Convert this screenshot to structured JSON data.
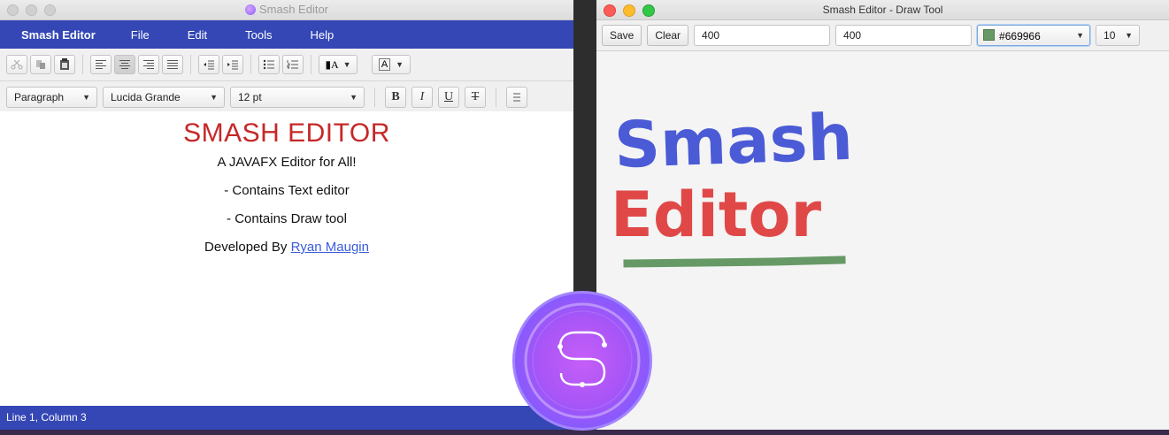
{
  "editor": {
    "window_title": "Smash Editor",
    "menu": [
      "Smash Editor",
      "File",
      "Edit",
      "Tools",
      "Help"
    ],
    "format": {
      "paragraph_style": "Paragraph",
      "font_family": "Lucida Grande",
      "font_size": "12 pt",
      "bold_label": "B",
      "italic_label": "I",
      "underline_label": "U",
      "strike_label": "T"
    },
    "document": {
      "heading": "SMASH EDITOR",
      "line1": "A JAVAFX Editor for All!",
      "line2": "- Contains Text editor",
      "line3": "- Contains Draw tool",
      "developed_prefix": "Developed By ",
      "developer_link": "Ryan Maugin"
    },
    "status": "Line 1, Column 3",
    "colors": {
      "accent": "#3447b5",
      "heading": "#c62828",
      "link": "#3b5bdb"
    }
  },
  "draw": {
    "window_title": "Smash Editor - Draw Tool",
    "save_label": "Save",
    "clear_label": "Clear",
    "width_value": "400",
    "height_value": "400",
    "color_value": "#669966",
    "brush_size": "10",
    "canvas_text": {
      "line1": "Smash",
      "line2": "Editor"
    },
    "colors": {
      "stroke1": "#4b5bd6",
      "stroke2": "#e04848",
      "stroke3": "#669966"
    }
  }
}
